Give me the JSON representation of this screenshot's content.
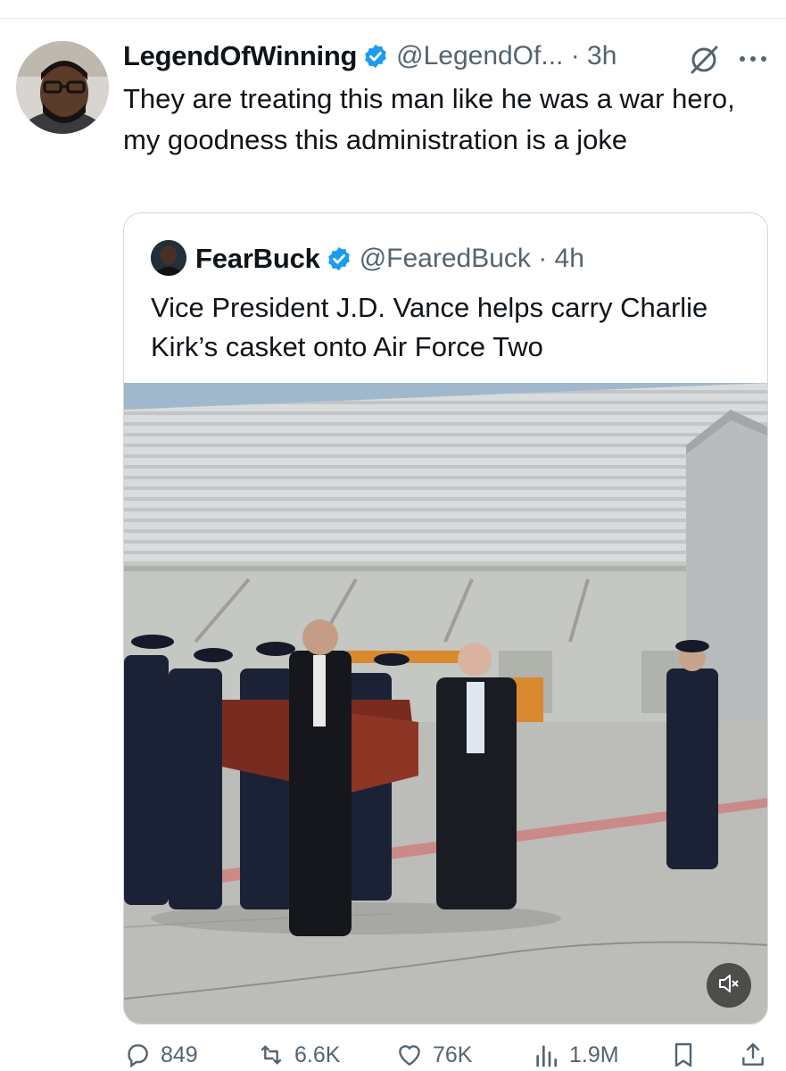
{
  "tweet": {
    "display_name": "LegendOfWinning",
    "handle_time": "@LegendOf... · 3h",
    "text": "They are treating this man like he was a war hero, my goodness this administration is a joke"
  },
  "quote": {
    "display_name": "FearBuck",
    "handle_time": "@FearedBuck · 4h",
    "text": "Vice President J.D. Vance helps carry Charlie Kirk’s casket onto Air Force Two"
  },
  "actions": {
    "replies": "849",
    "reposts": "6.6K",
    "likes": "76K",
    "views": "1.9M"
  },
  "icons": [
    "verified-badge-icon",
    "grok-icon",
    "more-icon",
    "mute-icon",
    "reply-icon",
    "repost-icon",
    "like-icon",
    "views-icon",
    "bookmark-icon",
    "share-icon"
  ],
  "colors": {
    "verified": "#1d9bf0",
    "secondary_text": "#536471",
    "border": "#cfd9de"
  }
}
